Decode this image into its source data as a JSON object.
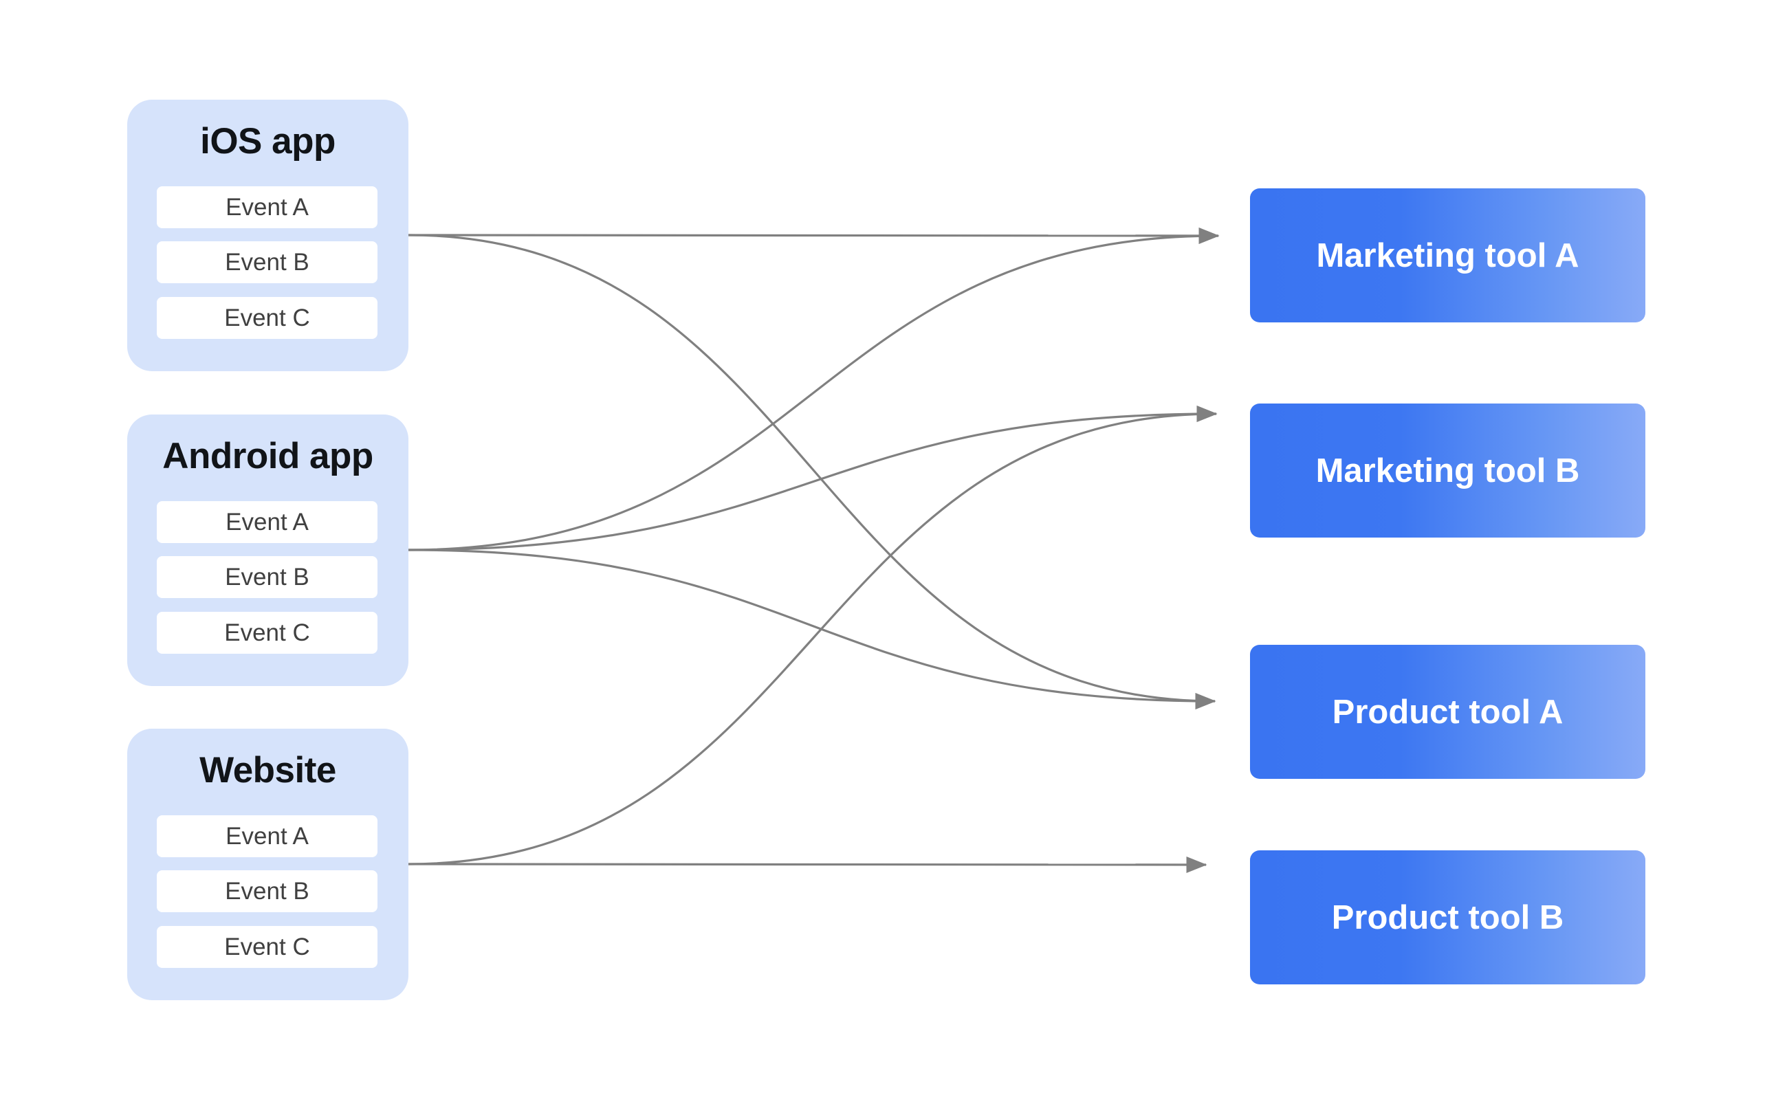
{
  "sources": [
    {
      "id": "ios",
      "title": "iOS app",
      "events": [
        "Event A",
        "Event B",
        "Event C"
      ]
    },
    {
      "id": "android",
      "title": "Android app",
      "events": [
        "Event A",
        "Event B",
        "Event C"
      ]
    },
    {
      "id": "website",
      "title": "Website",
      "events": [
        "Event A",
        "Event B",
        "Event C"
      ]
    }
  ],
  "destinations": [
    {
      "id": "marketing-a",
      "label": "Marketing tool A"
    },
    {
      "id": "marketing-b",
      "label": "Marketing tool B"
    },
    {
      "id": "product-a",
      "label": "Product tool A"
    },
    {
      "id": "product-b",
      "label": "Product tool B"
    }
  ],
  "connections": [
    {
      "from": "ios",
      "to": "marketing-a"
    },
    {
      "from": "ios",
      "to": "product-a"
    },
    {
      "from": "android",
      "to": "marketing-a"
    },
    {
      "from": "android",
      "to": "marketing-b"
    },
    {
      "from": "android",
      "to": "product-a"
    },
    {
      "from": "website",
      "to": "marketing-b"
    },
    {
      "from": "website",
      "to": "product-b"
    }
  ],
  "colors": {
    "source_box": "#d6e3fb",
    "event_box": "#ffffff",
    "destination_start": "#3a74f1",
    "destination_end": "#88aaf7",
    "connector": "#808080"
  }
}
